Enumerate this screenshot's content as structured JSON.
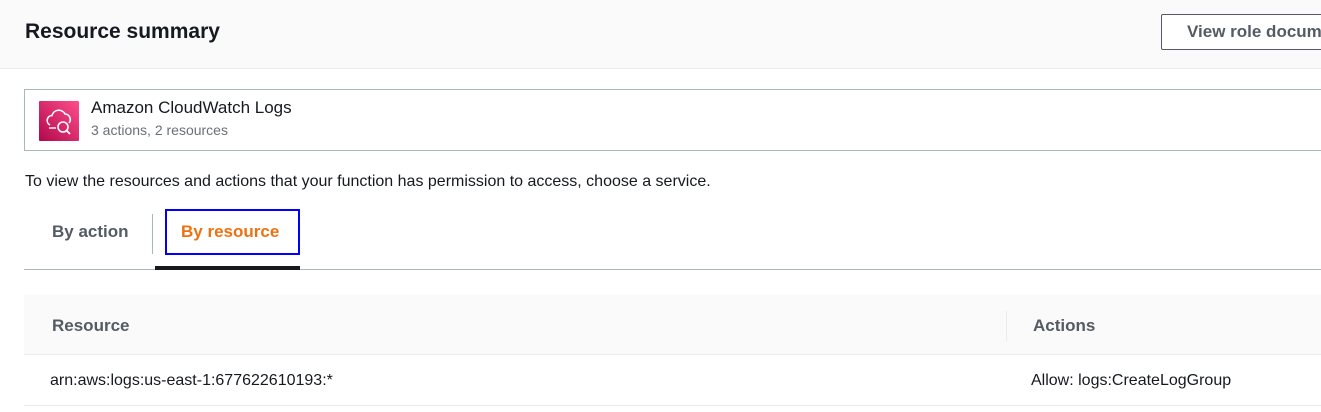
{
  "header": {
    "title": "Resource summary",
    "view_role_button": "View role document"
  },
  "service_card": {
    "icon": "cloudwatch-logs-icon",
    "name": "Amazon CloudWatch Logs",
    "summary": "3 actions, 2 resources"
  },
  "instruction": "To view the resources and actions that your function has permission to access, choose a service.",
  "tabs": [
    {
      "label": "By action",
      "selected": false
    },
    {
      "label": "By resource",
      "selected": true
    }
  ],
  "table": {
    "columns": [
      "Resource",
      "Actions"
    ],
    "rows": [
      {
        "resource": "arn:aws:logs:us-east-1:677622610193:*",
        "actions": "Allow: logs:CreateLogGroup"
      }
    ]
  },
  "colors": {
    "selected_tab": "#ec7211",
    "focus_outline": "#0000ff",
    "service_icon": "#e7157b"
  }
}
